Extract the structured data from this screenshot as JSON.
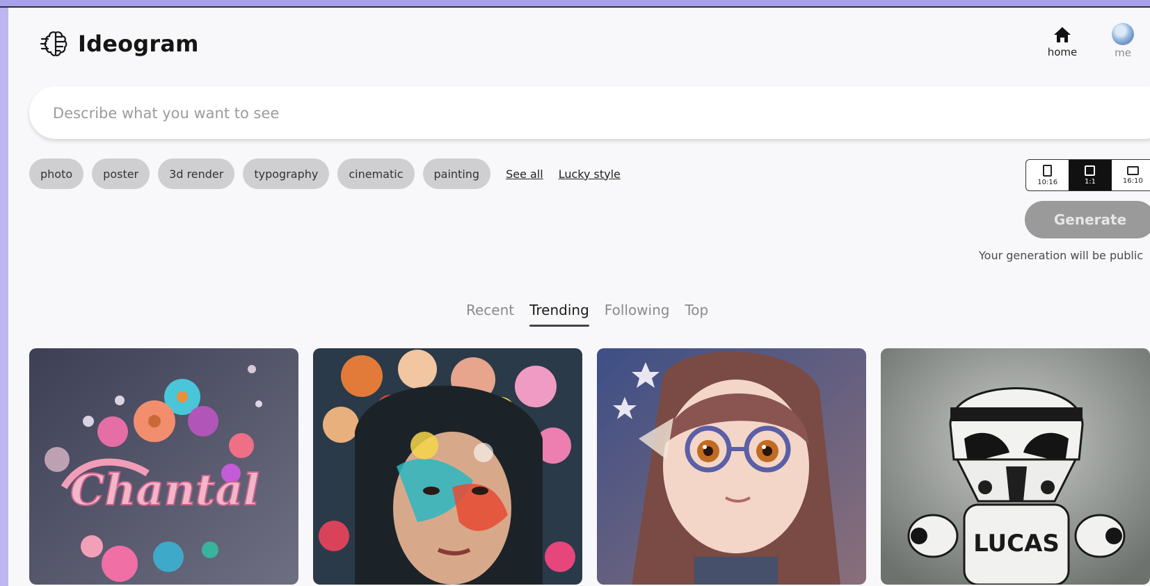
{
  "app": {
    "name": "Ideogram"
  },
  "nav": {
    "home_label": "home",
    "me_label": "me"
  },
  "search": {
    "placeholder": "Describe what you want to see",
    "value": ""
  },
  "style_chips": [
    "photo",
    "poster",
    "3d render",
    "typography",
    "cinematic",
    "painting"
  ],
  "links": {
    "see_all": "See all",
    "lucky_style": "Lucky style"
  },
  "aspect_ratios": [
    {
      "label": "10:16",
      "selected": false
    },
    {
      "label": "1:1",
      "selected": true
    },
    {
      "label": "16:10",
      "selected": false
    }
  ],
  "generate": {
    "label": "Generate",
    "disabled": true,
    "note": "Your generation will be public"
  },
  "feed_tabs": [
    {
      "label": "Recent",
      "active": false
    },
    {
      "label": "Trending",
      "active": true
    },
    {
      "label": "Following",
      "active": false
    },
    {
      "label": "Top",
      "active": false
    }
  ],
  "cards": [
    {
      "text": "Chantal"
    },
    {
      "text": ""
    },
    {
      "text": ""
    },
    {
      "text": "LUCAS"
    }
  ],
  "colors": {
    "accent_selected": "#111111",
    "generate_bg": "#9a9a9a",
    "window_bg": "#f8f8fa"
  }
}
